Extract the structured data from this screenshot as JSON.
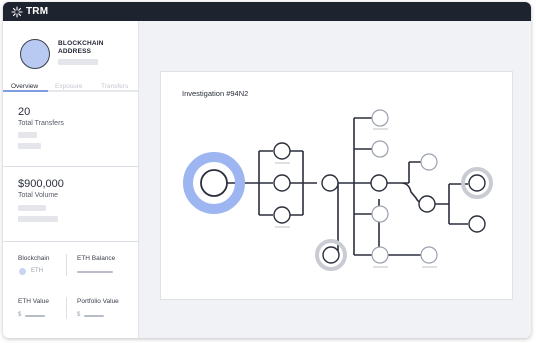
{
  "app": {
    "logo_text": "TRM"
  },
  "sidebar": {
    "header_title": "BLOCKCHAIN ADDRESS",
    "tabs": [
      {
        "label": "Overview",
        "active": true
      },
      {
        "label": "Exposure",
        "active": false
      },
      {
        "label": "Transfers",
        "active": false
      }
    ],
    "transfers": {
      "value": "20",
      "label": "Total Transfers"
    },
    "volume": {
      "value": "$900,000",
      "label": "Total Volume"
    },
    "blockchain": {
      "label": "Blockchain",
      "value": "ETH"
    },
    "eth_balance": {
      "label": "ETH Balance"
    },
    "eth_value": {
      "label": "ETH Value",
      "prefix": "$"
    },
    "portfolio_value": {
      "label": "Portfolio Value",
      "prefix": "$"
    }
  },
  "investigation": {
    "title": "Investigation #94N2"
  },
  "colors": {
    "accent": "#7f9ee0",
    "ring_blue": "#9db5f0",
    "ring_gray": "#c9ccd2",
    "dark": "#1e2330"
  }
}
